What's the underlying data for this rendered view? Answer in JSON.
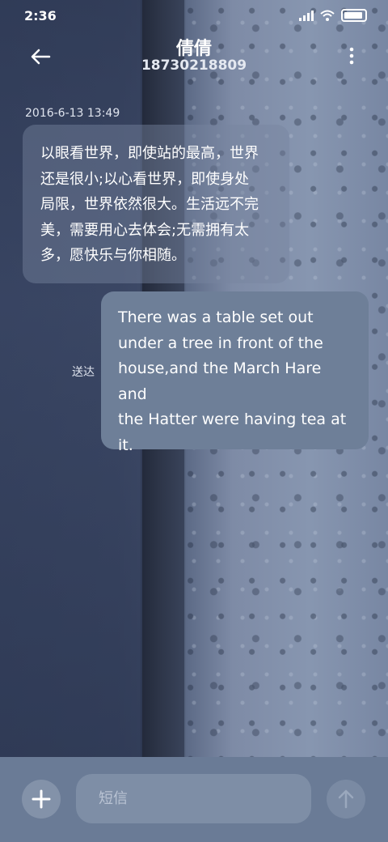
{
  "status_bar": {
    "time": "2:36",
    "icons": [
      "signal-icon",
      "wifi-icon",
      "battery-icon"
    ]
  },
  "header": {
    "contact_name": "倩倩",
    "phone_number": "18730218809",
    "back_icon": "back-arrow-icon",
    "menu_icon": "more-vert-icon"
  },
  "conversation": {
    "timestamp": "2016-6-13 13:49",
    "messages": [
      {
        "direction": "incoming",
        "lines": [
          "以眼看世界，即使站的最高，世界",
          "还是很小;以心看世界，即使身处",
          "局限，世界依然很大。生活远不完",
          "美，需要用心去体会;无需拥有太",
          "多，愿快乐与你相随。"
        ]
      },
      {
        "direction": "outgoing",
        "lines": [
          "There was a table set out",
          "under a tree in front of the",
          "house,and the March Hare and",
          "the Hatter were having tea at",
          "it."
        ],
        "status": "送达"
      }
    ]
  },
  "composer": {
    "placeholder": "短信",
    "add_icon": "plus-icon",
    "send_icon": "send-arrow-icon"
  },
  "colors": {
    "outgoing_bubble": "#6e7f98",
    "composer_bar": "#6a7b96",
    "text": "#ffffff"
  }
}
